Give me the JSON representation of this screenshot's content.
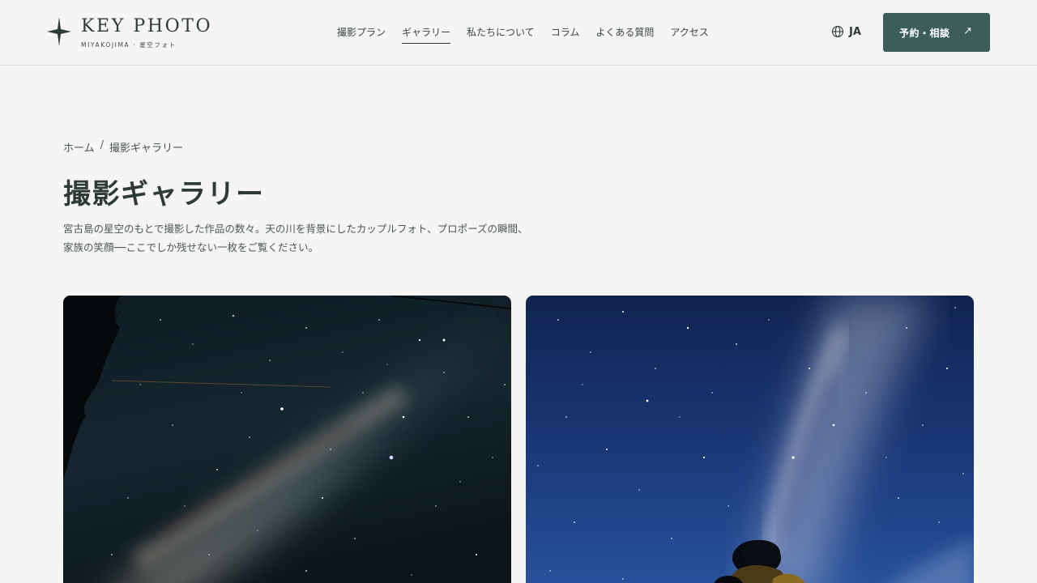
{
  "header": {
    "logo_title": "KEY PHOTO",
    "logo_subtitle": "MIYAKOJIMA · 星空フォト",
    "nav": [
      {
        "label": "撮影プラン",
        "active": false
      },
      {
        "label": "ギャラリー",
        "active": true
      },
      {
        "label": "私たちについて",
        "active": false
      },
      {
        "label": "コラム",
        "active": false
      },
      {
        "label": "よくある質問",
        "active": false
      },
      {
        "label": "アクセス",
        "active": false
      }
    ],
    "lang_label": "JA",
    "lang_icon": "globe-icon",
    "cta_label": "予約・相談",
    "cta_arrow": "↗"
  },
  "breadcrumb": {
    "home": "ホーム",
    "separator": "/",
    "current": "撮影ギャラリー"
  },
  "main": {
    "title": "撮影ギャラリー",
    "description_line1": "宮古島の星空のもとで撮影した作品の数々。天の川を背景にしたカップルフォト、プロポーズの瞬間、",
    "description_line2": "家族の笑顔──ここでしか残せない一枚をご覧ください。"
  },
  "gallery": [
    {
      "image": "milky-way-with-trees-photo"
    },
    {
      "image": "couple-under-milky-way-photo"
    }
  ],
  "colors": {
    "background": "#f5f5f3",
    "accent": "#3c5e59",
    "text": "#2e3a38"
  }
}
